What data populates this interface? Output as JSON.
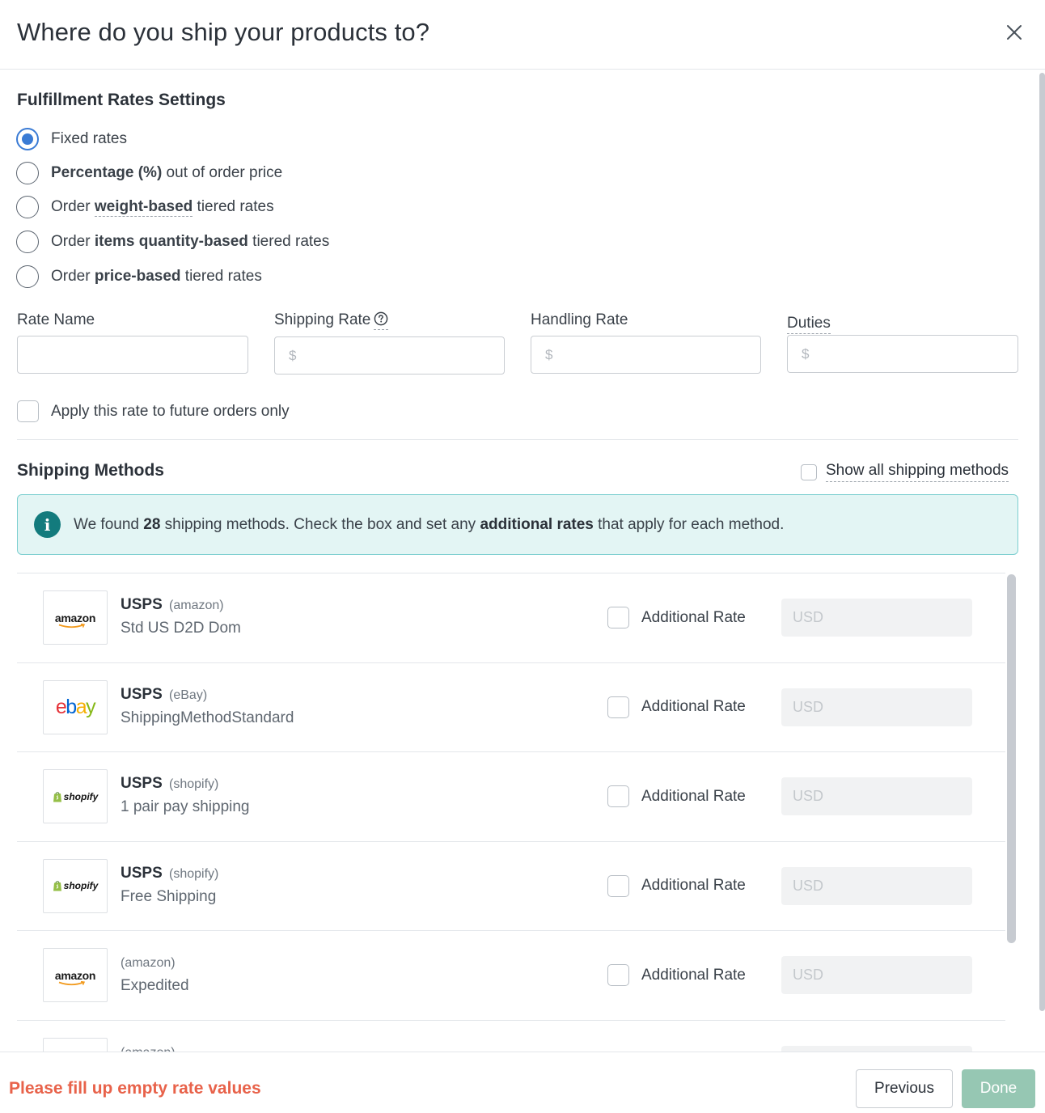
{
  "header": {
    "title": "Where do you ship your products to?"
  },
  "fulfillment": {
    "title": "Fulfillment Rates Settings",
    "options": [
      {
        "pre": "",
        "bold": "",
        "post": "Fixed rates",
        "checked": true
      },
      {
        "pre": "",
        "bold": "Percentage (%)",
        "post": " out of order price",
        "checked": false
      },
      {
        "pre": "Order ",
        "bold": "weight-based",
        "post": " tiered rates",
        "checked": false
      },
      {
        "pre": "Order ",
        "bold": "items quantity-based",
        "post": " tiered rates",
        "checked": false
      },
      {
        "pre": "Order ",
        "bold": "price-based",
        "post": " tiered rates",
        "checked": false
      }
    ]
  },
  "fields": {
    "rate_name": {
      "label": "Rate Name",
      "value": ""
    },
    "shipping_rate": {
      "label": "Shipping Rate",
      "placeholder": "$"
    },
    "handling_rate": {
      "label": "Handling Rate",
      "placeholder": "$"
    },
    "duties": {
      "label": "Duties",
      "placeholder": "$"
    }
  },
  "future_only": {
    "label": "Apply this rate to future orders only",
    "checked": false
  },
  "shipping_methods": {
    "title": "Shipping Methods",
    "show_all_label": "Show all shipping methods",
    "info": {
      "pre": "We found ",
      "count": "28",
      "mid": " shipping methods. Check the box and set any ",
      "bold": "additional rates",
      "post": " that apply for each method."
    },
    "items": [
      {
        "logo": "amazon",
        "carrier": "USPS",
        "source": "(amazon)",
        "name": "Std US D2D Dom",
        "check_label": "Additional Rate",
        "placeholder": "USD"
      },
      {
        "logo": "ebay",
        "carrier": "USPS",
        "source": "(eBay)",
        "name": "ShippingMethodStandard",
        "check_label": "Additional Rate",
        "placeholder": "USD"
      },
      {
        "logo": "shopify",
        "carrier": "USPS",
        "source": "(shopify)",
        "name": "1 pair pay shipping",
        "check_label": "Additional Rate",
        "placeholder": "USD"
      },
      {
        "logo": "shopify",
        "carrier": "USPS",
        "source": "(shopify)",
        "name": "Free Shipping",
        "check_label": "Additional Rate",
        "placeholder": "USD"
      },
      {
        "logo": "amazon",
        "carrier": "",
        "source": "(amazon)",
        "name": "Expedited",
        "check_label": "Additional Rate",
        "placeholder": "USD"
      },
      {
        "logo": "amazon",
        "carrier": "",
        "source": "(amazon)",
        "name": "",
        "check_label": "",
        "placeholder": ""
      }
    ]
  },
  "logos": {
    "amazon": "amazon",
    "ebay": [
      "e",
      "b",
      "a",
      "y"
    ],
    "shopify": "shopify"
  },
  "footer": {
    "error": "Please fill up empty rate values",
    "previous": "Previous",
    "done": "Done"
  },
  "colors": {
    "primary": "#3a7bd5",
    "error": "#e8624a",
    "done_bg": "#96c7b3",
    "info_bg": "#e3f5f4",
    "info_icon": "#137b7d"
  },
  "icons": {
    "close": "close-icon",
    "help": "question-circle-icon",
    "info": "info-icon"
  }
}
